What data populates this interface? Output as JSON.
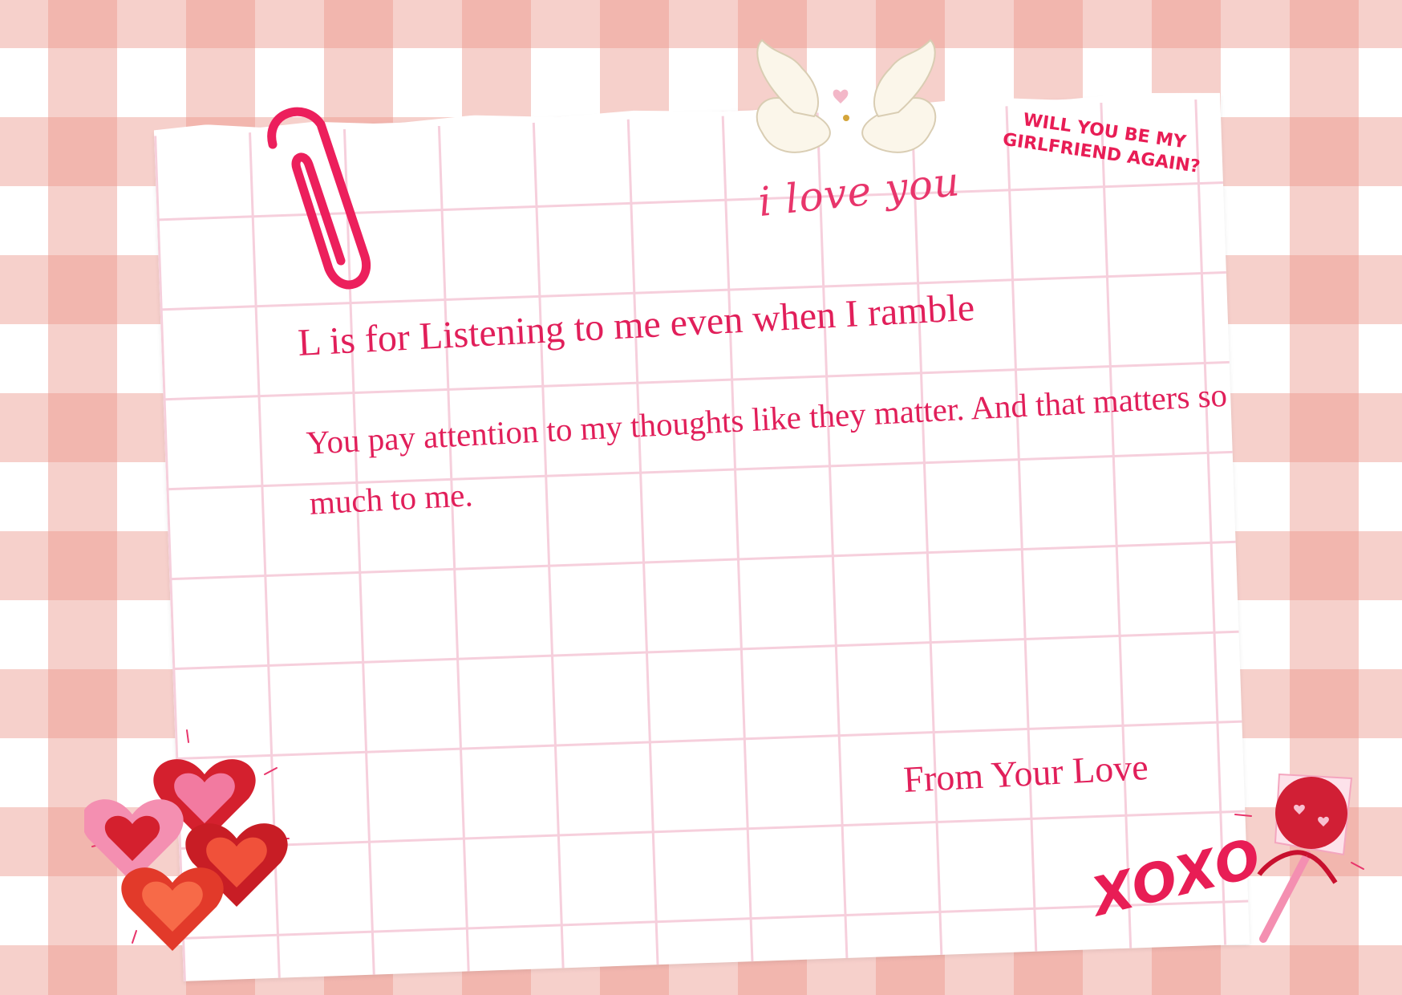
{
  "header": {
    "love_note": "i love you",
    "question": "WILL YOU BE MY GIRLFRIEND AGAIN?"
  },
  "letter": {
    "heading": "L is for Listening to me even when I ramble",
    "body": "You pay attention to my thoughts like they matter. And that matters so much to me.",
    "signoff": "From Your Love",
    "kisses": "XOXO"
  },
  "colors": {
    "accent": "#e11f5a",
    "gingham": "#ec968c",
    "grid": "#f6cfdc"
  },
  "icons": [
    "paperclip-icon",
    "doves-icon",
    "candy-hearts-icon",
    "lollipop-icon"
  ]
}
